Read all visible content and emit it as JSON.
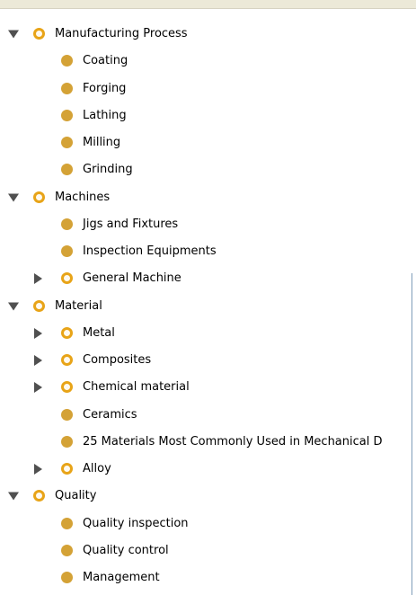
{
  "colors": {
    "class_dot": "#d4a236",
    "parent_dot_ring": "#e8a418",
    "toggle_arrow": "#505050",
    "header_background": "#ece9d8"
  },
  "tree": [
    {
      "label": "Manufacturing Process",
      "level": 0,
      "toggle": "expanded",
      "icon": "parent-class-icon"
    },
    {
      "label": "Coating",
      "level": 1,
      "toggle": "none",
      "icon": "class-icon"
    },
    {
      "label": "Forging",
      "level": 1,
      "toggle": "none",
      "icon": "class-icon"
    },
    {
      "label": "Lathing",
      "level": 1,
      "toggle": "none",
      "icon": "class-icon"
    },
    {
      "label": "Milling",
      "level": 1,
      "toggle": "none",
      "icon": "class-icon"
    },
    {
      "label": "Grinding",
      "level": 1,
      "toggle": "none",
      "icon": "class-icon"
    },
    {
      "label": "Machines",
      "level": 0,
      "toggle": "expanded",
      "icon": "parent-class-icon"
    },
    {
      "label": "Jigs and Fixtures",
      "level": 1,
      "toggle": "none",
      "icon": "class-icon"
    },
    {
      "label": "Inspection Equipments",
      "level": 1,
      "toggle": "none",
      "icon": "class-icon"
    },
    {
      "label": "General Machine",
      "level": 1,
      "toggle": "collapsed",
      "icon": "parent-class-icon"
    },
    {
      "label": "Material",
      "level": 0,
      "toggle": "expanded",
      "icon": "parent-class-icon"
    },
    {
      "label": "Metal",
      "level": 1,
      "toggle": "collapsed",
      "icon": "parent-class-icon"
    },
    {
      "label": "Composites",
      "level": 1,
      "toggle": "collapsed",
      "icon": "parent-class-icon"
    },
    {
      "label": "Chemical material",
      "level": 1,
      "toggle": "collapsed",
      "icon": "parent-class-icon"
    },
    {
      "label": "Ceramics",
      "level": 1,
      "toggle": "none",
      "icon": "class-icon"
    },
    {
      "label": "25 Materials Most Commonly Used in Mechanical D",
      "level": 1,
      "toggle": "none",
      "icon": "class-icon"
    },
    {
      "label": "Alloy",
      "level": 1,
      "toggle": "collapsed",
      "icon": "parent-class-icon"
    },
    {
      "label": "Quality",
      "level": 0,
      "toggle": "expanded",
      "icon": "parent-class-icon"
    },
    {
      "label": "Quality inspection",
      "level": 1,
      "toggle": "none",
      "icon": "class-icon"
    },
    {
      "label": "Quality control",
      "level": 1,
      "toggle": "none",
      "icon": "class-icon"
    },
    {
      "label": "Management",
      "level": 1,
      "toggle": "none",
      "icon": "class-icon"
    }
  ]
}
